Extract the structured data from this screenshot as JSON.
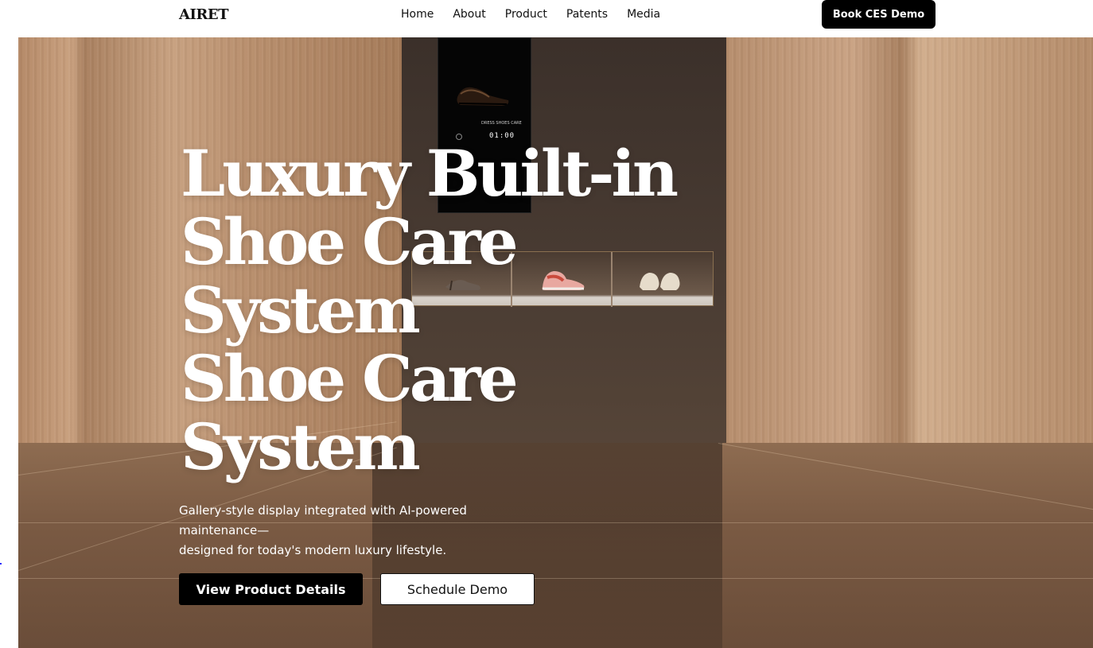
{
  "brand": {
    "logo": "AIRET"
  },
  "nav": {
    "items": [
      "Home",
      "About",
      "Product",
      "Patents",
      "Media"
    ],
    "cta": "Book CES Demo"
  },
  "hero": {
    "title_lines": [
      "Luxury Built-in",
      "Shoe Care",
      "System",
      "Shoe Care",
      "System"
    ],
    "subtitle_line1": "Gallery-style display integrated with AI-powered maintenance—",
    "subtitle_line2": "designed for today's modern luxury lifestyle.",
    "primary_button": "View Product Details",
    "secondary_button": "Schedule Demo",
    "screen": {
      "label": "DRESS SHOES CARE",
      "time": "01:00"
    }
  },
  "colors": {
    "accent": "#000000",
    "background": "#ffffff",
    "hero_tone": "#b78964"
  },
  "icons": [
    "power-icon",
    "dress-shoe-image",
    "sneaker-image",
    "heel-image"
  ]
}
